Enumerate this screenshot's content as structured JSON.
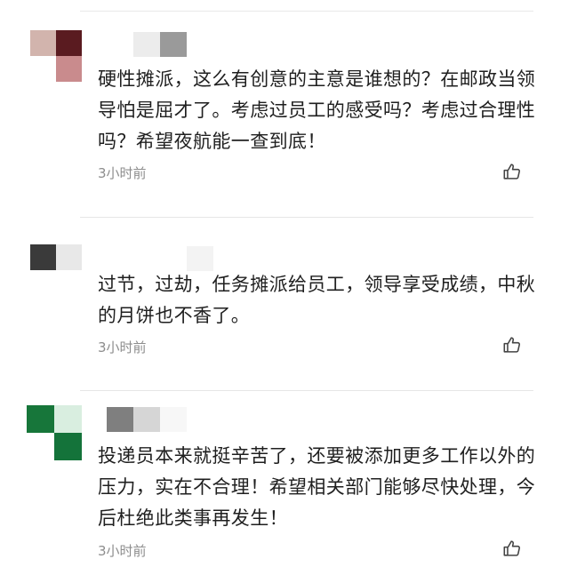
{
  "comments": [
    {
      "text": "硬性摊派，这么有创意的主意是谁想的？在邮政当领导怕是屈才了。考虑过员工的感受吗？考虑过合理性吗？希望夜航能一查到底！",
      "time": "3小时前",
      "avatar_colors": [
        "#d2b4ad",
        "#5a1b20",
        "#ffffff",
        "#c98b8d"
      ],
      "username_colors": [
        "#ececec",
        "#9a9a9a",
        "#ffffff"
      ]
    },
    {
      "text": "过节，过劫，任务摊派给员工，领导享受成绩，中秋的月饼也不香了。",
      "time": "3小时前",
      "avatar_colors": [
        "#3a3a3a",
        "#e8e8e8",
        "#ffffff",
        "#ffffff"
      ],
      "username_colors": [
        "#ffffff",
        "#ffffff",
        "#f3f3f3"
      ]
    },
    {
      "text": "投递员本来就挺辛苦了，还要被添加更多工作以外的压力，实在不合理！希望相关部门能够尽快处理，今后杜绝此类事再发生！",
      "time": "3小时前",
      "avatar_colors": [
        "#17763a",
        "#d9eee0",
        "#ffffff",
        "#14733a"
      ],
      "username_colors": [
        "#7f7f7f",
        "#d6d6d6",
        "#f7f7f7"
      ]
    }
  ],
  "like_icon_color": "#444444"
}
